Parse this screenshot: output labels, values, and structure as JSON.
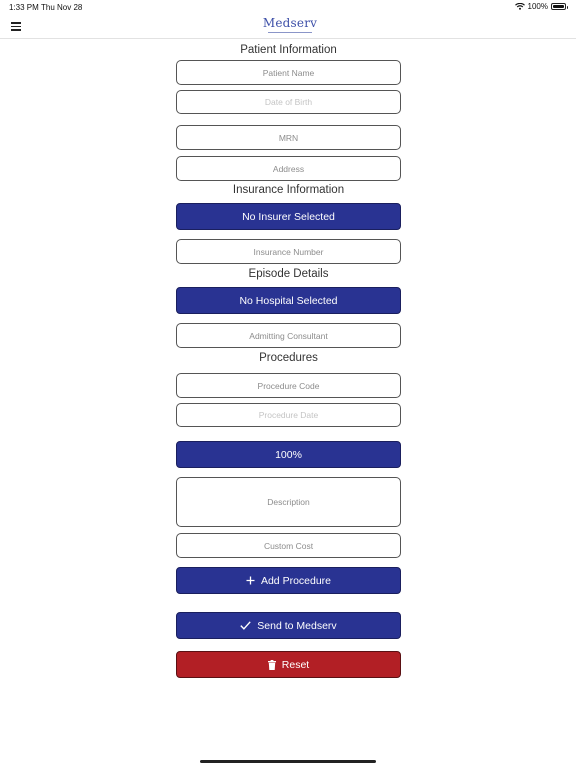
{
  "status_bar": {
    "time": "1:33 PM",
    "date": "Thu Nov 28",
    "battery": "100%"
  },
  "header": {
    "logo_text": "Medserv"
  },
  "patient": {
    "title": "Patient Information",
    "name_placeholder": "Patient Name",
    "dob_placeholder": "Date of Birth",
    "mrn_placeholder": "MRN",
    "address_placeholder": "Address"
  },
  "insurance": {
    "title": "Insurance Information",
    "insurer_button": "No Insurer Selected",
    "number_placeholder": "Insurance Number"
  },
  "episode": {
    "title": "Episode Details",
    "hospital_button": "No Hospital Selected",
    "consultant_placeholder": "Admitting Consultant"
  },
  "procedures": {
    "title": "Procedures",
    "code_placeholder": "Procedure Code",
    "date_placeholder": "Procedure Date",
    "percentage_button": "100%",
    "description_placeholder": "Description",
    "cost_placeholder": "Custom Cost"
  },
  "actions": {
    "add_procedure": "Add Procedure",
    "send": "Send to Medserv",
    "reset": "Reset"
  },
  "colors": {
    "primary": "#293392",
    "danger": "#b21f25",
    "logo": "#3d4fa8"
  }
}
